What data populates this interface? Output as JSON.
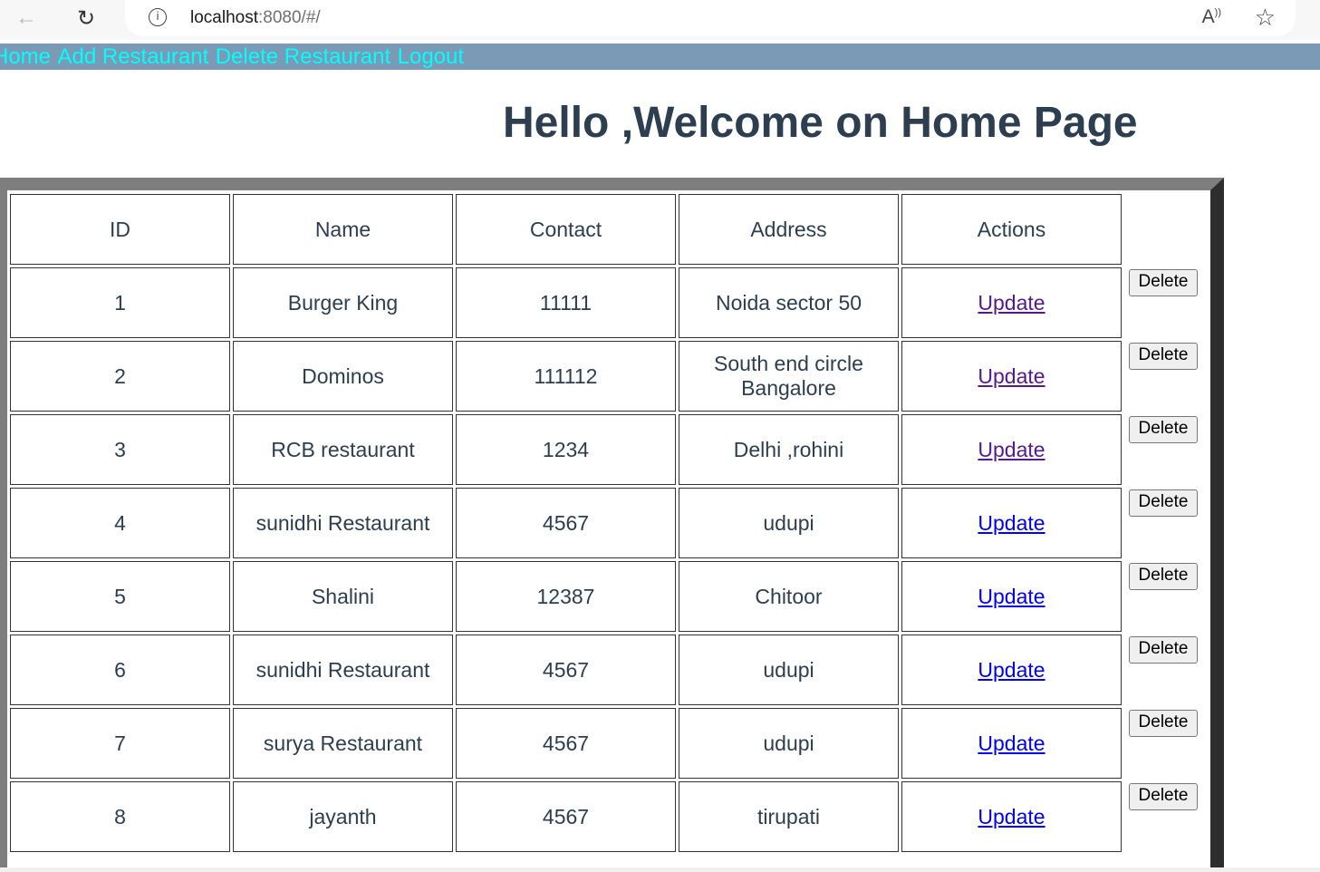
{
  "browser": {
    "url_host": "localhost",
    "url_rest": ":8080/#/",
    "back_icon": "←",
    "reload_icon": "↻",
    "info_icon": "i",
    "read_aloud_icon": "A",
    "favorite_icon": "☆"
  },
  "nav": {
    "home": "Home",
    "add": "Add Restaurant",
    "delete": "Delete Restaurant",
    "logout": "Logout",
    "link_color": "#00ffff",
    "bar_color": "#7b9ab6"
  },
  "title": "Hello ,Welcome on Home Page",
  "table": {
    "headers": {
      "id": "ID",
      "name": "Name",
      "contact": "Contact",
      "address": "Address",
      "actions": "Actions"
    },
    "update_label": "Update",
    "delete_label": "Delete",
    "rows": [
      {
        "id": "1",
        "name": "Burger King",
        "contact": "11111",
        "address": "Noida sector 50"
      },
      {
        "id": "2",
        "name": "Dominos",
        "contact": "111112",
        "address": "South end circle Bangalore"
      },
      {
        "id": "3",
        "name": "RCB restaurant",
        "contact": "1234",
        "address": "Delhi ,rohini"
      },
      {
        "id": "4",
        "name": "sunidhi Restaurant",
        "contact": "4567",
        "address": "udupi"
      },
      {
        "id": "5",
        "name": "Shalini",
        "contact": "12387",
        "address": "Chitoor"
      },
      {
        "id": "6",
        "name": "sunidhi Restaurant",
        "contact": "4567",
        "address": "udupi"
      },
      {
        "id": "7",
        "name": "surya Restaurant",
        "contact": "4567",
        "address": "udupi"
      },
      {
        "id": "8",
        "name": "jayanth",
        "contact": "4567",
        "address": "tirupati"
      }
    ]
  }
}
